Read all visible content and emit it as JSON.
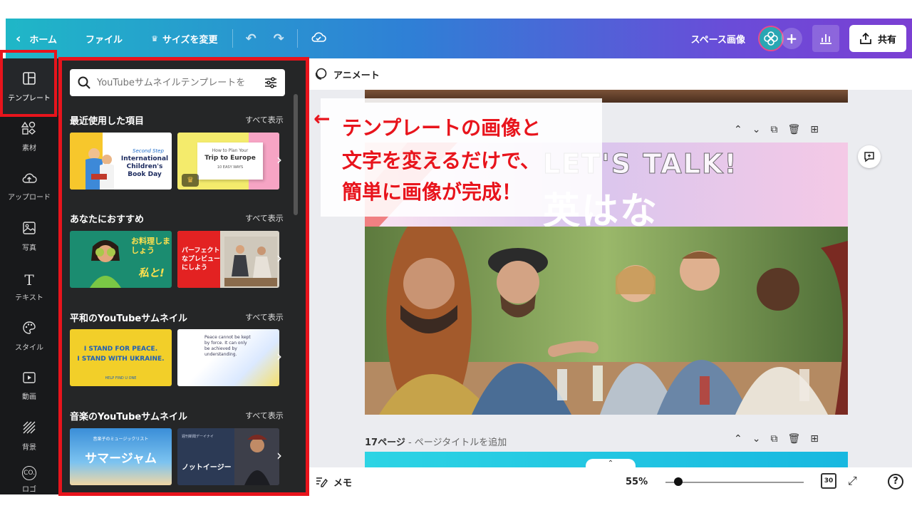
{
  "topbar": {
    "home": "ホーム",
    "file": "ファイル",
    "resize": "サイズを変更",
    "space_title": "スペース画像",
    "share": "共有"
  },
  "rail": {
    "items": [
      {
        "label": "テンプレート",
        "icon": "layout-icon"
      },
      {
        "label": "素材",
        "icon": "shapes-icon"
      },
      {
        "label": "アップロード",
        "icon": "cloud-upload-icon"
      },
      {
        "label": "写真",
        "icon": "image-icon"
      },
      {
        "label": "テキスト",
        "icon": "text-icon"
      },
      {
        "label": "スタイル",
        "icon": "palette-icon"
      },
      {
        "label": "動画",
        "icon": "video-icon"
      },
      {
        "label": "背景",
        "icon": "pattern-icon"
      },
      {
        "label": "ロゴ",
        "icon": "logo-icon"
      }
    ]
  },
  "panel": {
    "search_placeholder": "YouTubeサムネイルテンプレートを",
    "see_all": "すべて表示",
    "sections": [
      {
        "title": "最近使用した項目"
      },
      {
        "title": "あなたにおすすめ"
      },
      {
        "title": "平和のYouTubeサムネイル"
      },
      {
        "title": "音楽のYouTubeサムネイル"
      }
    ],
    "thumbs": {
      "t1": "International Children's Book Day",
      "t1_top": "Second Step",
      "t2_top": "How to Plan Your",
      "t2": "Trip to Europe",
      "t2_sub": "10 EASY WAYS",
      "t3": "お料理しましょう",
      "t3_b": "私と!",
      "t4": "パーフェクトなプレビューにしよう",
      "t5_a": "I STAND FOR PEACE.",
      "t5_b": "I STAND WITH UKRAINE.",
      "t5_c": "HELP FIND U ONE",
      "t6": "Peace cannot be kept by force. It can only be achieved by understanding.",
      "t7_top": "音楽子のミュージックリスト",
      "t7": "サマージャム",
      "t8_top": "週刊新聞デーイナイ",
      "t8": "ノットイージー"
    }
  },
  "canvas": {
    "animate": "アニメート",
    "design_talk": "LET'S TALK!",
    "design_name": "英はな",
    "page_num": "17ページ",
    "page_title_placeholder": " - ページタイトルを追加"
  },
  "annotation": {
    "line1": "テンプレートの画像と",
    "line2": "文字を変えるだけで、",
    "line3": "簡単に画像が完成！"
  },
  "bottombar": {
    "memo": "メモ",
    "zoom": "55%",
    "page_count": "30"
  },
  "colors": {
    "highlight": "#e8141c",
    "annotation_text": "#e8141c"
  }
}
